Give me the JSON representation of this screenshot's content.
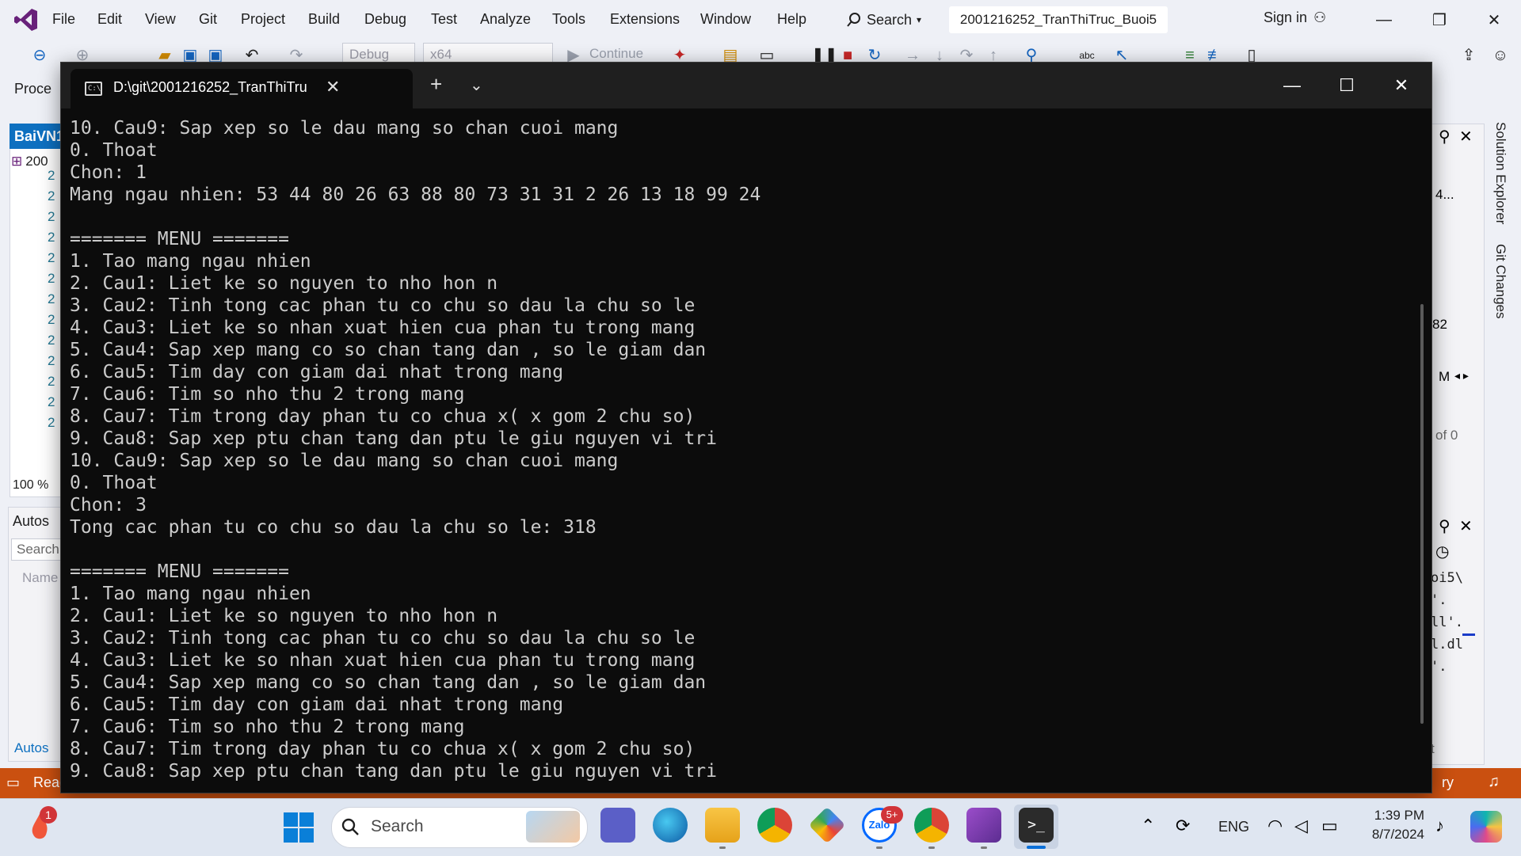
{
  "vs": {
    "menu": [
      "File",
      "Edit",
      "View",
      "Git",
      "Project",
      "Build",
      "Debug",
      "Test",
      "Analyze",
      "Tools",
      "Extensions",
      "Window",
      "Help"
    ],
    "search_label": "Search",
    "solution_title": "2001216252_TranThiTruc_Buoi5",
    "signin_label": "Sign in",
    "toolbar": {
      "config": "Debug",
      "platform": "x64",
      "continue_label": "Continue"
    },
    "process_label": "Proce",
    "left_tab_label": "BaiVN1",
    "left_item_label": "200",
    "line_numbers": [
      "2",
      "2",
      "2",
      "2",
      "2",
      "2",
      "2",
      "2",
      "2",
      "2",
      "2",
      "2",
      "2"
    ],
    "zoom_label": "100 %",
    "autos_title": "Autos",
    "autos_search": "Search",
    "autos_name_col": "Name",
    "autos_tab": "Autos",
    "status_text": "Read",
    "status_right": "ry",
    "right_panel_fragments": [
      "4...",
      "82",
      "M",
      "of 0",
      "oi5\\",
      "'.",
      "ll'.",
      "l.dl",
      "'.",
      "t"
    ],
    "vertical_tabs": [
      "Solution Explorer",
      "Git Changes"
    ]
  },
  "terminal": {
    "tab_title": "D:\\git\\2001216252_TranThiTru",
    "lines": [
      "10. Cau9: Sap xep so le dau mang so chan cuoi mang",
      "0. Thoat",
      "Chon: 1",
      "Mang ngau nhien: 53 44 80 26 63 88 80 73 31 31 2 26 13 18 99 24",
      "",
      "======= MENU =======",
      "1. Tao mang ngau nhien",
      "2. Cau1: Liet ke so nguyen to nho hon n",
      "3. Cau2: Tinh tong cac phan tu co chu so dau la chu so le",
      "4. Cau3: Liet ke so nhan xuat hien cua phan tu trong mang",
      "5. Cau4: Sap xep mang co so chan tang dan , so le giam dan",
      "6. Cau5: Tim day con giam dai nhat trong mang",
      "7. Cau6: Tim so nho thu 2 trong mang",
      "8. Cau7: Tim trong day phan tu co chua x( x gom 2 chu so)",
      "9. Cau8: Sap xep ptu chan tang dan ptu le giu nguyen vi tri",
      "10. Cau9: Sap xep so le dau mang so chan cuoi mang",
      "0. Thoat",
      "Chon: 3",
      "Tong cac phan tu co chu so dau la chu so le: 318",
      "",
      "======= MENU =======",
      "1. Tao mang ngau nhien",
      "2. Cau1: Liet ke so nguyen to nho hon n",
      "3. Cau2: Tinh tong cac phan tu co chu so dau la chu so le",
      "4. Cau3: Liet ke so nhan xuat hien cua phan tu trong mang",
      "5. Cau4: Sap xep mang co so chan tang dan , so le giam dan",
      "6. Cau5: Tim day con giam dai nhat trong mang",
      "7. Cau6: Tim so nho thu 2 trong mang",
      "8. Cau7: Tim trong day phan tu co chua x( x gom 2 chu so)",
      "9. Cau8: Sap xep ptu chan tang dan ptu le giu nguyen vi tri"
    ]
  },
  "taskbar": {
    "search_label": "Search",
    "notification_badge": "1",
    "zalo_badge": "5+",
    "lang": "ENG",
    "time": "1:39 PM",
    "date": "8/7/2024",
    "icons": [
      "teams-icon",
      "edge-icon",
      "file-explorer-icon",
      "chrome-icon",
      "gemini-icon",
      "zalo-icon",
      "chrome-profile-icon",
      "visual-studio-icon",
      "terminal-icon"
    ]
  },
  "colors": {
    "vs_accent": "#68217a",
    "status_bar": "#ca5010",
    "terminal_bg": "#0c0c0c",
    "terminal_text": "#cccccc",
    "left_tab": "#0e70c0"
  }
}
